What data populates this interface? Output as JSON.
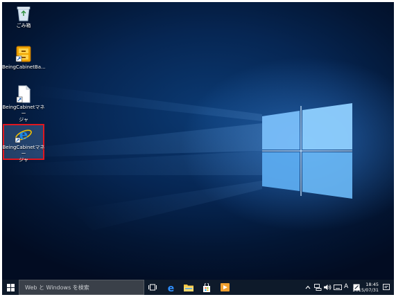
{
  "desktop": {
    "icons": [
      {
        "label_line1": "ごみ箱",
        "label_line2": ""
      },
      {
        "label_line1": "BeingCabinetBa...",
        "label_line2": ""
      },
      {
        "label_line1": "BeingCabinetマネー",
        "label_line2": "ジャ"
      },
      {
        "label_line1": "BeingCabinetマネー",
        "label_line2": "ジャ"
      }
    ],
    "selection_color": "#e0171f"
  },
  "taskbar": {
    "search_placeholder": "Web と Windows を検索",
    "ime_mode": "A",
    "clock_time": "18:45",
    "clock_date": "2015/07/31",
    "accent": "#0078d7"
  }
}
